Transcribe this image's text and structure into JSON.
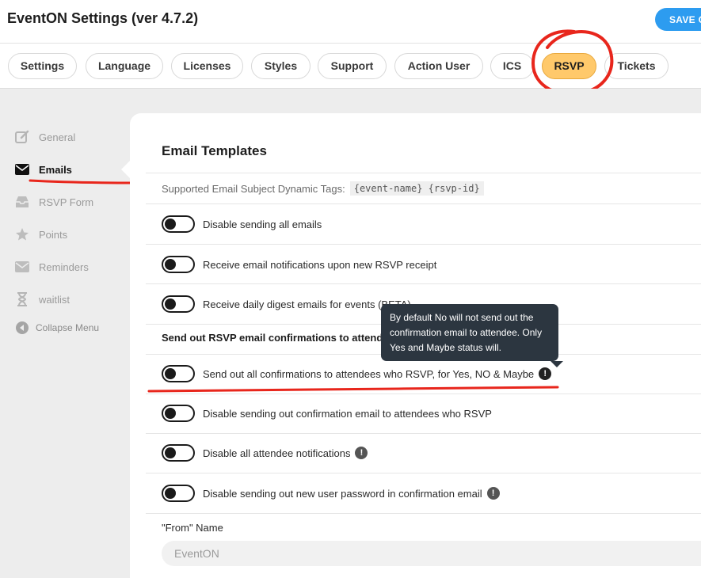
{
  "header": {
    "title": "EventON Settings (ver 4.7.2)",
    "save_label": "SAVE CHANGES"
  },
  "tabs": [
    {
      "label": "Settings"
    },
    {
      "label": "Language"
    },
    {
      "label": "Licenses"
    },
    {
      "label": "Styles"
    },
    {
      "label": "Support"
    },
    {
      "label": "Action User"
    },
    {
      "label": "ICS"
    },
    {
      "label": "RSVP",
      "active": true
    },
    {
      "label": "Tickets"
    }
  ],
  "sidebar": {
    "items": [
      {
        "label": "General",
        "icon": "edit-icon"
      },
      {
        "label": "Emails",
        "icon": "envelope-icon",
        "active": true
      },
      {
        "label": "RSVP Form",
        "icon": "inbox-icon"
      },
      {
        "label": "Points",
        "icon": "star-icon"
      },
      {
        "label": "Reminders",
        "icon": "envelope-icon"
      },
      {
        "label": "waitlist",
        "icon": "hourglass-icon"
      },
      {
        "label": "Collapse Menu",
        "icon": "collapse-arrow-icon"
      }
    ]
  },
  "main": {
    "section_title": "Email Templates",
    "tags_label": "Supported Email Subject Dynamic Tags:",
    "tags": [
      "{event-name}",
      "{rsvp-id}"
    ],
    "toggles": [
      {
        "label": "Disable sending all emails",
        "on": false
      },
      {
        "label": "Receive email notifications upon new RSVP receipt",
        "on": false
      },
      {
        "label": "Receive daily digest emails for events (BETA)",
        "on": false
      }
    ],
    "subheading": "Send out RSVP email confirmations to attendees",
    "toggles2": [
      {
        "label": "Send out all confirmations to attendees who RSVP, for Yes, NO & Maybe",
        "on": false,
        "info": true
      },
      {
        "label": "Disable sending out confirmation email to attendees who RSVP",
        "on": false
      },
      {
        "label": "Disable all attendee notifications",
        "on": false,
        "info": true
      },
      {
        "label": "Disable sending out new user password in confirmation email",
        "on": false,
        "info": true
      }
    ],
    "tooltip": "By default No will not send out the confirmation email to attendee. Only Yes and Maybe status will.",
    "from_name_label": "\"From\" Name",
    "from_name_placeholder": "EventON"
  },
  "colors": {
    "accent": "#2d9cf0",
    "active_tab": "#ffc96b",
    "annotation": "#e8261c"
  }
}
